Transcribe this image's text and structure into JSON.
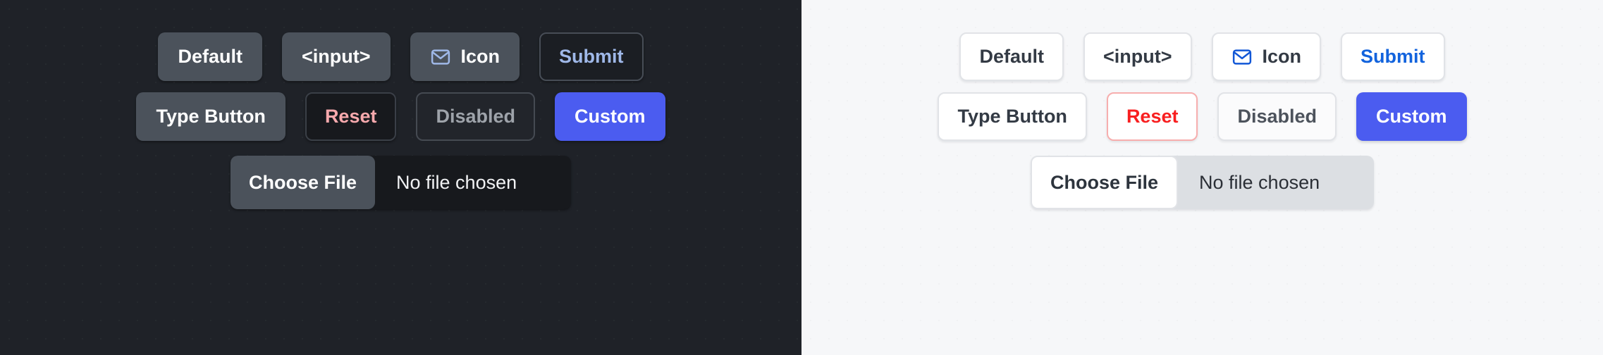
{
  "panels": [
    {
      "theme": "dark",
      "background": "#1f2228",
      "rows": [
        {
          "buttons": [
            {
              "label": "Default",
              "variant": "default",
              "name": "default-button",
              "icon": null
            },
            {
              "label": "<input>",
              "variant": "input",
              "name": "input-button",
              "icon": null
            },
            {
              "label": "Icon",
              "variant": "icon",
              "name": "icon-button",
              "icon": "envelope-icon"
            },
            {
              "label": "Submit",
              "variant": "submit",
              "name": "submit-button",
              "icon": null
            }
          ]
        },
        {
          "buttons": [
            {
              "label": "Type Button",
              "variant": "type",
              "name": "type-button",
              "icon": null
            },
            {
              "label": "Reset",
              "variant": "reset",
              "name": "reset-button",
              "icon": null
            },
            {
              "label": "Disabled",
              "variant": "disabled",
              "name": "disabled-button",
              "icon": null
            },
            {
              "label": "Custom",
              "variant": "custom",
              "name": "custom-button",
              "icon": null
            }
          ]
        }
      ],
      "file_input": {
        "button_label": "Choose File",
        "status_text": "No file chosen"
      },
      "colors": {
        "surface": "#4b525b",
        "text": "#ffffff",
        "submit_text": "#9fb8e8",
        "reset_text": "#f7a9ad",
        "disabled_text": "#9ea3aa",
        "custom_bg": "#4b5cf0",
        "icon_stroke": "#9fb8e8"
      }
    },
    {
      "theme": "light",
      "background": "#f6f7f9",
      "rows": [
        {
          "buttons": [
            {
              "label": "Default",
              "variant": "default",
              "name": "default-button",
              "icon": null
            },
            {
              "label": "<input>",
              "variant": "input",
              "name": "input-button",
              "icon": null
            },
            {
              "label": "Icon",
              "variant": "icon",
              "name": "icon-button",
              "icon": "envelope-icon"
            },
            {
              "label": "Submit",
              "variant": "submit",
              "name": "submit-button",
              "icon": null
            }
          ]
        },
        {
          "buttons": [
            {
              "label": "Type Button",
              "variant": "type",
              "name": "type-button",
              "icon": null
            },
            {
              "label": "Reset",
              "variant": "reset",
              "name": "reset-button",
              "icon": null
            },
            {
              "label": "Disabled",
              "variant": "disabled",
              "name": "disabled-button",
              "icon": null
            },
            {
              "label": "Custom",
              "variant": "custom",
              "name": "custom-button",
              "icon": null
            }
          ]
        }
      ],
      "file_input": {
        "button_label": "Choose File",
        "status_text": "No file chosen"
      },
      "colors": {
        "surface": "#ffffff",
        "text": "#333a44",
        "submit_text": "#1263dd",
        "reset_text": "#f81f20",
        "reset_border": "#f7aeae",
        "disabled_text": "#4d535c",
        "custom_bg": "#4b5cf0",
        "icon_stroke": "#1257d6",
        "border": "#e1e3e7",
        "file_track": "#dcdfe3"
      }
    }
  ]
}
